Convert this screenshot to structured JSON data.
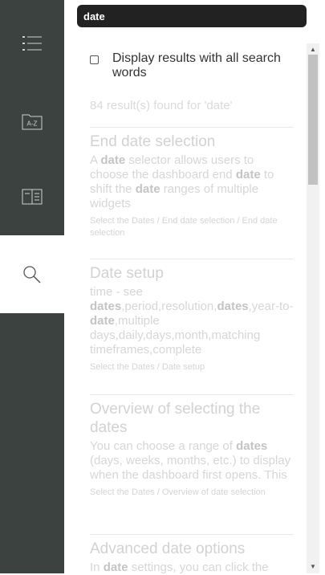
{
  "search": {
    "value": "date"
  },
  "options": {
    "all_words_label": "Display results with all search words",
    "all_words_checked": false
  },
  "nav": {
    "tabs": [
      {
        "icon": "table-of-contents-icon",
        "active": false
      },
      {
        "icon": "index-a-z-icon",
        "icon_text": "A-Z",
        "active": false
      },
      {
        "icon": "glossary-book-icon",
        "active": false
      },
      {
        "icon": "search-icon",
        "active": true
      }
    ]
  },
  "results": {
    "count_text": "84 result(s) found for 'date'",
    "items": [
      {
        "title": "End date selection",
        "body": [
          {
            "t": "A "
          },
          {
            "t": "date",
            "b": true
          },
          {
            "t": " selector allows users to choose the dashboard end "
          },
          {
            "t": "date",
            "b": true
          },
          {
            "t": " to shift the "
          },
          {
            "t": "date",
            "b": true
          },
          {
            "t": " ranges of multiple widgets"
          }
        ],
        "path": "Select the Dates / End date selection / End date selection"
      },
      {
        "title": "Date setup",
        "body": [
          {
            "t": "time - see "
          },
          {
            "t": "dates",
            "b": true
          },
          {
            "t": ",period,resolution,"
          },
          {
            "t": "dates",
            "b": true
          },
          {
            "t": ",year-to-"
          },
          {
            "t": "date",
            "b": true
          },
          {
            "t": ",multiple days,daily,days,month,matching timeframes,complete"
          }
        ],
        "path": "Select the Dates / Date setup"
      },
      {
        "title": "Overview of selecting the dates",
        "body": [
          {
            "t": "You can choose a range of "
          },
          {
            "t": "dates",
            "b": true
          },
          {
            "t": " (days, weeks, months, etc.) to display when the dashboard first opens. This"
          }
        ],
        "path": "Select the Dates / Overview of date selection"
      },
      {
        "title": "Advanced date options",
        "body": [
          {
            "t": "In "
          },
          {
            "t": "date",
            "b": true
          },
          {
            "t": " settings, you can click the"
          }
        ],
        "path": ""
      }
    ]
  },
  "colors": {
    "rail": "#3b4240",
    "search_bg": "#222222",
    "result_text": "#d2d2d2"
  }
}
